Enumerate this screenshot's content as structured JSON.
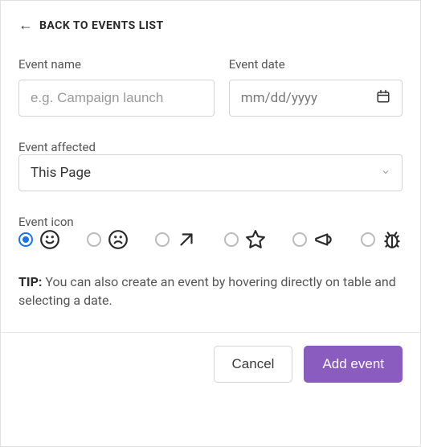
{
  "back_label": "BACK TO EVENTS LIST",
  "fields": {
    "name": {
      "label": "Event name",
      "placeholder": "e.g. Campaign launch",
      "value": ""
    },
    "date": {
      "label": "Event date",
      "placeholder": "mm/dd/yyyy",
      "value": ""
    },
    "affected": {
      "label": "Event affected",
      "selected": "This Page"
    },
    "icon": {
      "label": "Event icon",
      "options": [
        {
          "id": "smile",
          "selected": true
        },
        {
          "id": "frown",
          "selected": false
        },
        {
          "id": "arrow-up-right",
          "selected": false
        },
        {
          "id": "star",
          "selected": false
        },
        {
          "id": "megaphone",
          "selected": false
        },
        {
          "id": "bug",
          "selected": false
        }
      ]
    }
  },
  "tip": {
    "label": "TIP:",
    "text": "You can also create an event by hovering directly on table and selecting a date."
  },
  "buttons": {
    "cancel": "Cancel",
    "submit": "Add event"
  }
}
